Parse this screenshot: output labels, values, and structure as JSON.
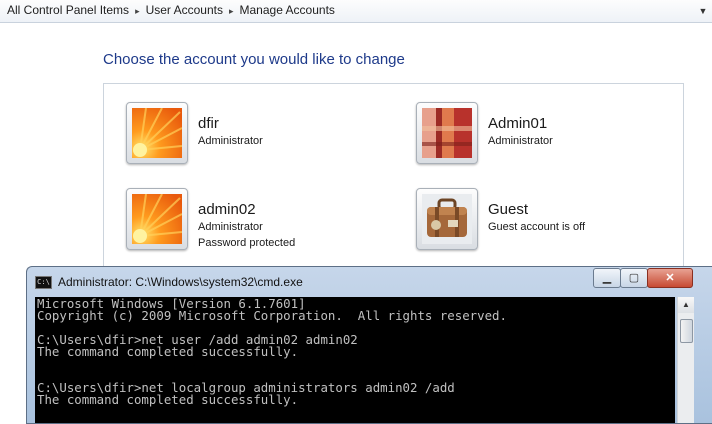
{
  "breadcrumb": {
    "items": [
      "All Control Panel Items",
      "User Accounts",
      "Manage Accounts"
    ]
  },
  "main": {
    "heading": "Choose the account you would like to change",
    "accounts": [
      {
        "name": "dfir",
        "role": "Administrator",
        "extra": "",
        "picture": "orange-flower-icon"
      },
      {
        "name": "Admin01",
        "role": "Administrator",
        "extra": "",
        "picture": "red-fabric-icon"
      },
      {
        "name": "admin02",
        "role": "Administrator",
        "extra": "Password protected",
        "picture": "orange-flower-icon"
      },
      {
        "name": "Guest",
        "role": "Guest account is off",
        "extra": "",
        "picture": "suitcase-icon"
      }
    ]
  },
  "cmd": {
    "title": "Administrator: C:\\Windows\\system32\\cmd.exe",
    "icon_label": "C:\\",
    "output": "Microsoft Windows [Version 6.1.7601]\nCopyright (c) 2009 Microsoft Corporation.  All rights reserved.\n\nC:\\Users\\dfir>net user /add admin02 admin02\nThe command completed successfully.\n\n\nC:\\Users\\dfir>net localgroup administrators admin02 /add\nThe command completed successfully.\n"
  },
  "colors": {
    "heading": "#1e3a8a",
    "console_bg": "#000000",
    "console_text": "#c0c0c0"
  }
}
